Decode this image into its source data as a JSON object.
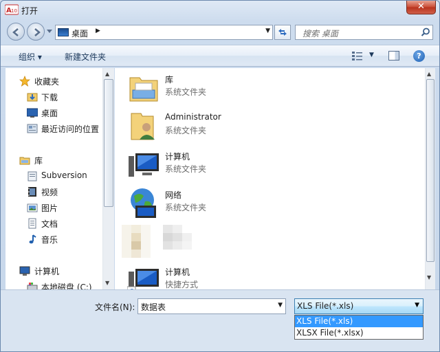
{
  "window": {
    "title": "打开",
    "close_label": "✕"
  },
  "address": {
    "location": "桌面",
    "search_placeholder": "搜索 桌面"
  },
  "toolbar": {
    "organize_label": "组织 ▾",
    "new_folder_label": "新建文件夹",
    "help_label": "?"
  },
  "sidebar": {
    "items": [
      {
        "label": "收藏夹",
        "icon": "star-icon"
      },
      {
        "label": "下载",
        "icon": "download-folder-icon"
      },
      {
        "label": "桌面",
        "icon": "desktop-icon"
      },
      {
        "label": "最近访问的位置",
        "icon": "recent-places-icon"
      },
      {
        "label": "库",
        "icon": "library-icon"
      },
      {
        "label": "Subversion",
        "icon": "folder-icon"
      },
      {
        "label": "视频",
        "icon": "video-icon"
      },
      {
        "label": "图片",
        "icon": "pictures-icon"
      },
      {
        "label": "文档",
        "icon": "documents-icon"
      },
      {
        "label": "音乐",
        "icon": "music-icon"
      },
      {
        "label": "计算机",
        "icon": "computer-icon"
      },
      {
        "label": "本地磁盘 (C:)",
        "icon": "drive-icon"
      }
    ]
  },
  "files": [
    {
      "name": "库",
      "desc": "系统文件夹",
      "icon": "library-folder-icon"
    },
    {
      "name": "Administrator",
      "desc": "系统文件夹",
      "icon": "user-folder-icon"
    },
    {
      "name": "计算机",
      "desc": "系统文件夹",
      "icon": "computer-icon"
    },
    {
      "name": "网络",
      "desc": "系统文件夹",
      "icon": "network-icon"
    },
    {
      "name": "计算机",
      "desc": "快捷方式",
      "icon": "computer-shortcut-icon"
    }
  ],
  "footer": {
    "filename_label": "文件名(N):",
    "filename_value": "数据表",
    "filetype_value": "XLS File(*.xls)",
    "filetype_options": [
      "XLS File(*.xls)",
      "XLSX File(*.xlsx)"
    ]
  },
  "colors": {
    "selection": "#3399ff",
    "close_button": "#c94a33"
  }
}
